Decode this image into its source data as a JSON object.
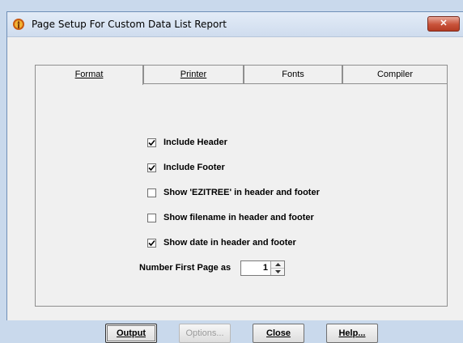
{
  "window": {
    "title": "Page Setup For Custom Data List Report",
    "close_label": "✕"
  },
  "tabs": [
    {
      "label": "Format",
      "active": true
    },
    {
      "label": "Printer",
      "active": false
    },
    {
      "label": "Fonts",
      "active": false
    },
    {
      "label": "Compiler",
      "active": false
    }
  ],
  "format": {
    "checkboxes": [
      {
        "label": "Include Header",
        "checked": true
      },
      {
        "label": "Include Footer",
        "checked": true
      },
      {
        "label": "Show 'EZITREE' in header and footer",
        "checked": false
      },
      {
        "label": "Show filename in header and footer",
        "checked": false
      },
      {
        "label": "Show date in header and footer",
        "checked": true
      }
    ],
    "number_first_page_label": "Number First Page as",
    "number_first_page_value": "1"
  },
  "buttons": {
    "output": "Output",
    "options": "Options...",
    "close": "Close",
    "help": "Help..."
  }
}
